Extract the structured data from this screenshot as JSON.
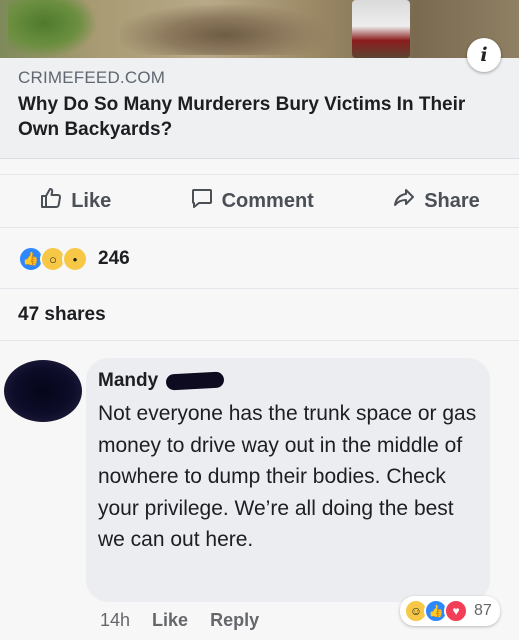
{
  "post": {
    "link": {
      "source": "CRIMEFEED.COM",
      "headline": "Why Do So Many Murderers Bury Victims In Their Own Backyards?"
    },
    "actions": {
      "like_label": "Like",
      "comment_label": "Comment",
      "share_label": "Share"
    },
    "reactions": {
      "count": "246",
      "types": [
        "like-icon",
        "wow-icon",
        "sad-icon"
      ]
    },
    "shares_label": "47 shares"
  },
  "comment": {
    "author": "Mandy",
    "text": "Not everyone has the trunk space or gas money to drive way out in the middle of nowhere to dump their bodies. Check your privilege. We’re all doing the best we can out here.",
    "time": "14h",
    "like_label": "Like",
    "reply_label": "Reply",
    "reaction_count": "87",
    "reaction_types": [
      "haha-icon",
      "like-icon",
      "love-icon"
    ]
  },
  "colors": {
    "like_blue": "#2d88ff",
    "reaction_yellow": "#f7c846",
    "love_red": "#f33e58",
    "bubble": "#ebedf0"
  }
}
